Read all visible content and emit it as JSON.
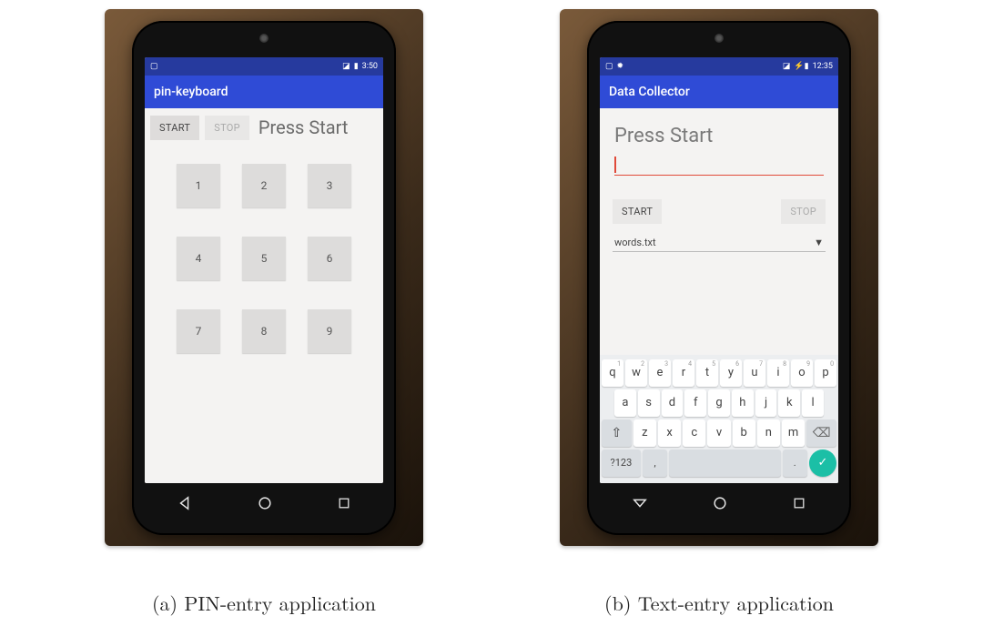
{
  "captions": {
    "a": "(a) PIN-entry application",
    "b": "(b) Text-entry application"
  },
  "pin_phone": {
    "status_time": "3:50",
    "app_title": "pin-keyboard",
    "start_label": "START",
    "stop_label": "STOP",
    "prompt": "Press Start",
    "keys": [
      "1",
      "2",
      "3",
      "4",
      "5",
      "6",
      "7",
      "8",
      "9"
    ]
  },
  "text_phone": {
    "status_time": "12:35",
    "app_title": "Data Collector",
    "prompt": "Press Start",
    "start_label": "START",
    "stop_label": "STOP",
    "spinner_value": "words.txt",
    "keyboard": {
      "row1": [
        {
          "k": "q",
          "h": "1"
        },
        {
          "k": "w",
          "h": "2"
        },
        {
          "k": "e",
          "h": "3"
        },
        {
          "k": "r",
          "h": "4"
        },
        {
          "k": "t",
          "h": "5"
        },
        {
          "k": "y",
          "h": "6"
        },
        {
          "k": "u",
          "h": "7"
        },
        {
          "k": "i",
          "h": "8"
        },
        {
          "k": "o",
          "h": "9"
        },
        {
          "k": "p",
          "h": "0"
        }
      ],
      "row2": [
        "a",
        "s",
        "d",
        "f",
        "g",
        "h",
        "j",
        "k",
        "l"
      ],
      "row3": [
        "z",
        "x",
        "c",
        "v",
        "b",
        "n",
        "m"
      ],
      "sym_label": "?123",
      "comma": ",",
      "period": "."
    }
  }
}
